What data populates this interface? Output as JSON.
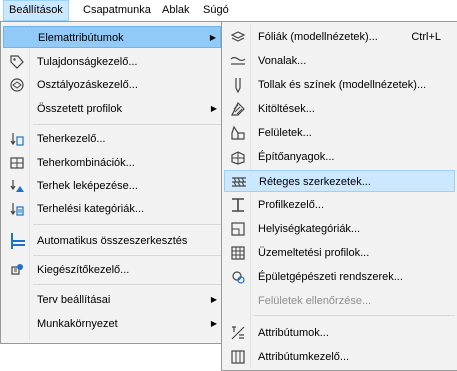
{
  "menubar": {
    "items": [
      "Beállítások",
      "Csapatmunka",
      "Ablak",
      "Súgó"
    ]
  },
  "menu1": {
    "items": [
      {
        "label": "Elemattribútumok",
        "icon": "",
        "arrow": true
      },
      {
        "label": "Tulajdonságkezelő...",
        "icon": "tag-icon"
      },
      {
        "label": "Osztályozáskezelő...",
        "icon": "classification-icon"
      },
      {
        "label": "Összetett profilok",
        "icon": "",
        "arrow": true
      },
      {
        "label": "Teherkezelő...",
        "icon": "load-manager-icon"
      },
      {
        "label": "Teherkombinációk...",
        "icon": "load-combination-icon"
      },
      {
        "label": "Terhek leképezése...",
        "icon": "load-mapping-icon"
      },
      {
        "label": "Terhelési kategóriák...",
        "icon": "load-category-icon"
      },
      {
        "label": "Automatikus összeszerkesztés",
        "icon": "auto-connect-icon"
      },
      {
        "label": "Kiegészítőkezelő...",
        "icon": "addon-manager-icon"
      },
      {
        "label": "Terv beállításai",
        "icon": "",
        "arrow": true
      },
      {
        "label": "Munkakörnyezet",
        "icon": "",
        "arrow": true
      }
    ]
  },
  "menu2": {
    "items": [
      {
        "label": "Fóliák (modellnézetek)...",
        "shortcut": "Ctrl+L",
        "icon": "layers-icon"
      },
      {
        "label": "Vonalak...",
        "icon": "line-types-icon"
      },
      {
        "label": "Tollak és színek (modellnézetek)...",
        "icon": "pen-icon"
      },
      {
        "label": "Kitöltések...",
        "icon": "fill-icon"
      },
      {
        "label": "Felületek...",
        "icon": "surface-icon"
      },
      {
        "label": "Építőanyagok...",
        "icon": "building-material-icon"
      },
      {
        "label": "Réteges szerkezetek...",
        "icon": "composites-icon"
      },
      {
        "label": "Profilkezelő...",
        "icon": "profile-manager-icon"
      },
      {
        "label": "Helyiségkategóriák...",
        "icon": "zone-category-icon"
      },
      {
        "label": "Üzemeltetési profilok...",
        "icon": "operation-profile-icon"
      },
      {
        "label": "Épületgépészeti rendszerek...",
        "icon": "mep-systems-icon"
      },
      {
        "label": "Felületek ellenőrzése...",
        "icon": "",
        "disabled": true
      },
      {
        "label": "Attribútumok...",
        "icon": "attributes-icon"
      },
      {
        "label": "Attribútumkezelő...",
        "icon": "attribute-manager-icon"
      }
    ]
  },
  "colors": {
    "highlight": "#91c9f7",
    "menubar_active": "#cce8ff",
    "menu_bg": "#f2f2f2"
  }
}
